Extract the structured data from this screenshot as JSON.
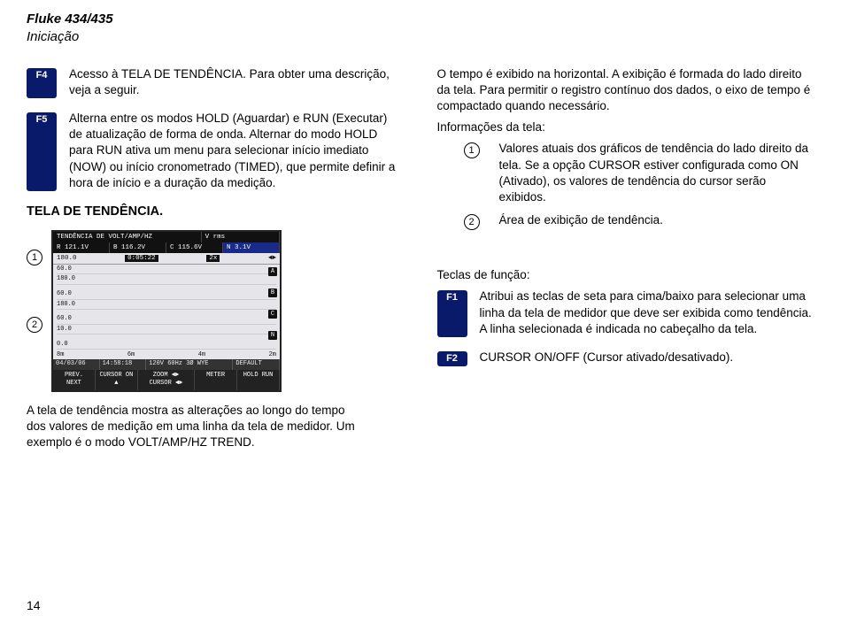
{
  "header": {
    "model": "Fluke 434/435",
    "subtitle": "Iniciação"
  },
  "left": {
    "f4": {
      "key": "F4",
      "text": "Acesso à TELA DE TENDÊNCIA. Para obter uma descrição, veja a seguir."
    },
    "f5": {
      "key": "F5",
      "text": "Alterna entre os modos HOLD (Aguardar) e RUN (Executar) de atualização de forma de onda. Alternar do modo HOLD para RUN ativa um menu para selecionar início imediato (NOW) ou início cronometrado (TIMED), que permite definir a hora de início e a duração da medição."
    },
    "section": "TELA DE TENDÊNCIA.",
    "callout1": "1",
    "callout2": "2",
    "caption": "A tela de tendência mostra as alterações ao longo do tempo dos valores de medição em uma linha da tela de medidor. Um exemplo é o modo VOLT/AMP/HZ TREND."
  },
  "right": {
    "intro": "O tempo é exibido na horizontal. A exibição é formada do lado direito da tela. Para permitir o registro contínuo dos dados, o eixo de tempo é compactado quando necessário.",
    "info_head": "Informações da tela:",
    "info1": {
      "n": "1",
      "text": "Valores atuais dos gráficos de tendência do lado direito da tela. Se a opção CURSOR estiver configurada como ON (Ativado), os valores de tendência do cursor serão exibidos."
    },
    "info2": {
      "n": "2",
      "text": "Área de exibição de tendência."
    },
    "fk_head": "Teclas de função:",
    "f1": {
      "key": "F1",
      "text": "Atribui as teclas de seta para cima/baixo para selecionar uma linha da tela de medidor que deve ser exibida como tendência. A linha selecionada é indicada no cabeçalho da tela."
    },
    "f2": {
      "key": "F2",
      "text": "CURSOR ON/OFF (Cursor ativado/desativado)."
    }
  },
  "instr": {
    "title": "TENDÊNCIA DE VOLT/AMP/HZ",
    "mode": "V rms",
    "row1": {
      "a": "R  121.1V",
      "b": "B  116.2V",
      "c": "C  115.6V",
      "n": "N    3.1V"
    },
    "row2": {
      "a": "180.0",
      "t": "0:05:22",
      "x": "2x",
      "arr": "◄►"
    },
    "yv": {
      "a1": "60.0",
      "a2": "180.0",
      "a3": "60.0",
      "a4": "180.0",
      "a5": "60.0",
      "a6": "10.0",
      "a7": "0.0"
    },
    "xa": {
      "a": "8m",
      "b": "6m",
      "c": "4m",
      "d": "2m"
    },
    "status": {
      "date": "04/03/06",
      "time": "14:58:18",
      "v": "120V 60Hz 3Ø WYE",
      "def": "DEFAULT"
    },
    "soft": {
      "s1": "PREV. NEXT",
      "s2": "CURSOR ON ▲",
      "s3": "ZOOM ◄► CURSOR ◄►",
      "s4": "METER",
      "s5": "HOLD RUN"
    },
    "ph": {
      "a": "A",
      "b": "B",
      "c": "C",
      "n": "N"
    }
  },
  "page": "14"
}
